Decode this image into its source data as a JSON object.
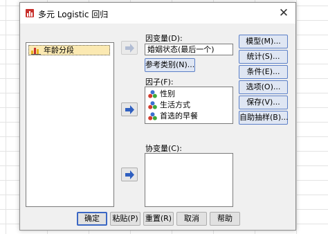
{
  "background_sheet": {
    "row_numbers": [
      "3"
    ]
  },
  "dialog": {
    "title": "多元 Logistic 回归",
    "close_glyph": "✕",
    "source_list": {
      "items": [
        {
          "label": "年龄分段",
          "icon": "scale-ruler-icon"
        }
      ]
    },
    "dependent": {
      "label": "因变量(D):",
      "value": "婚姻状态(最后一个)",
      "ref_button": "参考类别(N)..."
    },
    "factors": {
      "label": "因子(F):",
      "items": [
        {
          "label": "性别",
          "icon": "nominal-balls-icon"
        },
        {
          "label": "生活方式",
          "icon": "nominal-balls-icon"
        },
        {
          "label": "首选的早餐",
          "icon": "nominal-balls-icon"
        }
      ]
    },
    "covariates": {
      "label": "协变量(C):",
      "items": []
    },
    "side_buttons": [
      "模型(M)...",
      "统计(S)...",
      "条件(E)...",
      "选项(O)...",
      "保存(V)...",
      "自助抽样(B)..."
    ],
    "bottom_buttons": [
      "确定",
      "粘贴(P)",
      "重置(R)",
      "取消",
      "帮助"
    ],
    "colors": {
      "accent": "#3b67c4",
      "arrow_blue": "#2f5fc0",
      "selected_item": "#fbe9b2"
    }
  }
}
